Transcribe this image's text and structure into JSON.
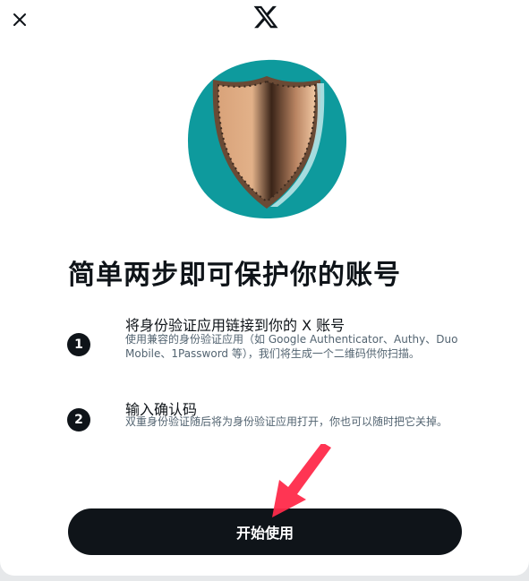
{
  "dialog": {
    "close_label": "×",
    "brand": "X"
  },
  "content": {
    "title": "简单两步即可保护你的账号",
    "steps": [
      {
        "number": "1",
        "title": "将身份验证应用链接到你的 X 账号",
        "description": "使用兼容的身份验证应用（如 Google Authenticator、Authy、Duo Mobile、1Password 等），我们将生成一个二维码供你扫描。"
      },
      {
        "number": "2",
        "title": "输入确认码",
        "description": "双重身份验证随后将为身份验证应用打开，你也可以随时把它关掉。"
      }
    ],
    "primary_button": "开始使用"
  },
  "colors": {
    "primary": "#0f1419",
    "secondary_text": "#536471",
    "illustration_bg": "#0e9a9d",
    "annotation_arrow": "#ff2a4a"
  },
  "icons": {
    "close": "close-icon",
    "logo": "x-logo-icon",
    "illustration": "shield-icon",
    "annotation": "red-arrow-icon"
  }
}
